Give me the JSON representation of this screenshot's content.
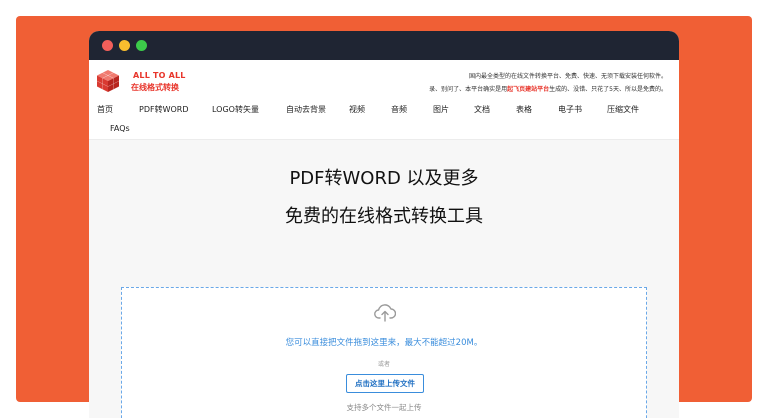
{
  "brand": {
    "logo_line1": "ALL TO ALL",
    "logo_line2": "在线格式转换",
    "accent_color": "#e8352b"
  },
  "header": {
    "tagline1": "国内最全类型的在线文件转换平台、免费、快速、无须下载安装任何软件。",
    "tagline2_pre": "录、别问了、本平台确实是用",
    "tagline2_highlight": "起飞页建站平台",
    "tagline2_post": "生成的、没错、只花了5天、所以是免费的。"
  },
  "nav": {
    "items": [
      "首页",
      "PDF转WORD",
      "LOGO转矢量",
      "自动去背景",
      "视频",
      "音频",
      "图片",
      "文档",
      "表格",
      "电子书",
      "压缩文件",
      "FAQs"
    ]
  },
  "hero": {
    "title_line1": "PDF转WORD 以及更多",
    "title_line2": "免费的在线格式转换工具"
  },
  "upload": {
    "drop_hint": "您可以直接把文件拖到这里来，最大不能超过20M。",
    "or_text": "或者",
    "button_label": "点击这里上传文件",
    "multi_hint": "支持多个文件一起上传",
    "icon": "cloud-upload-icon",
    "accent_color": "#3a8ddc"
  },
  "colors": {
    "frame_background": "#f05f35",
    "titlebar": "#1f2533"
  }
}
